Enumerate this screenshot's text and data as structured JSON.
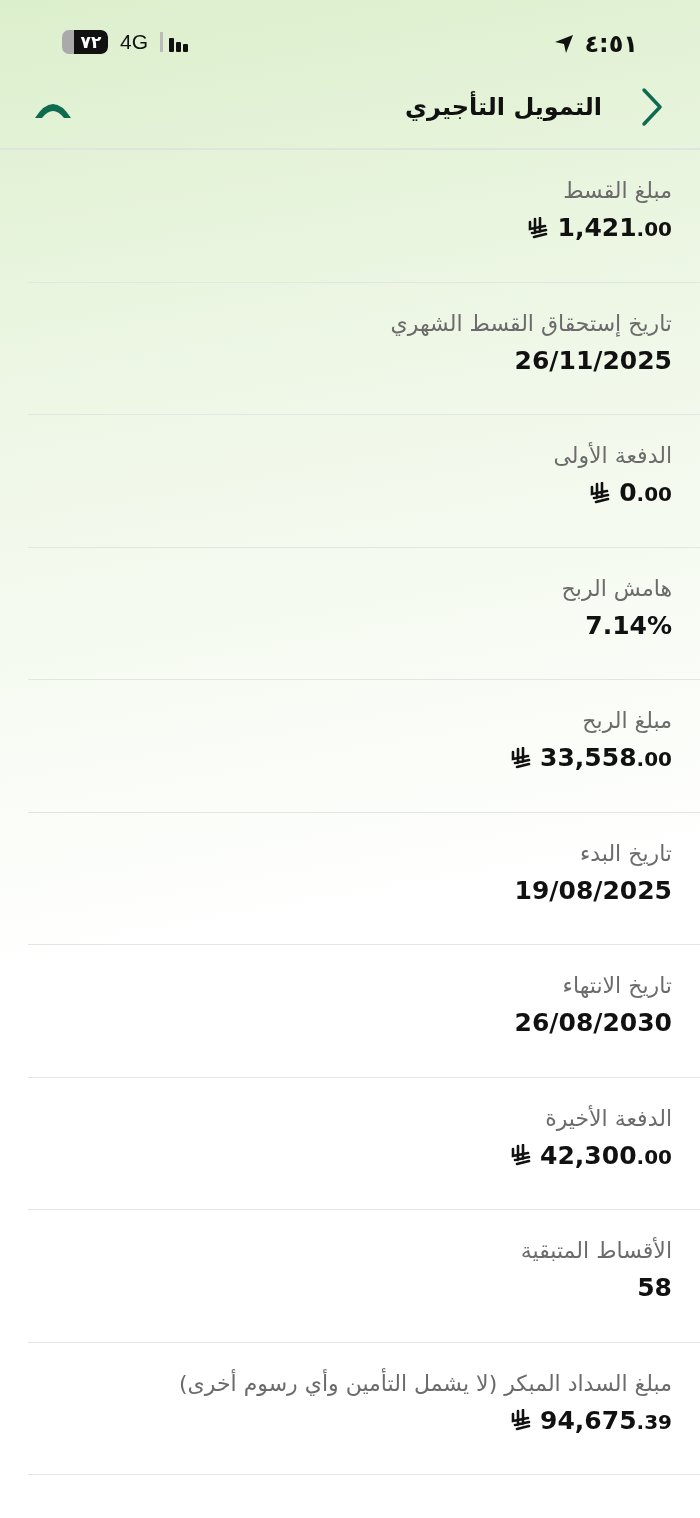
{
  "status_bar": {
    "time": "٤:٥١",
    "network": "4G",
    "battery": "٧٢"
  },
  "header": {
    "title": "التمويل التأجيري"
  },
  "rows": [
    {
      "label": "مبلغ القسط",
      "value": "1,421",
      "fraction": ".00",
      "currency": true
    },
    {
      "label": "تاريخ إستحقاق القسط الشهري",
      "value": "26/11/2025",
      "currency": false
    },
    {
      "label": "الدفعة الأولى",
      "value": "0",
      "fraction": ".00",
      "currency": true
    },
    {
      "label": "هامش الربح",
      "value": "7.14%",
      "currency": false
    },
    {
      "label": "مبلغ الربح",
      "value": "33,558",
      "fraction": ".00",
      "currency": true
    },
    {
      "label": "تاريخ البدء",
      "value": "19/08/2025",
      "currency": false
    },
    {
      "label": "تاريخ الانتهاء",
      "value": "26/08/2030",
      "currency": false
    },
    {
      "label": "الدفعة الأخيرة",
      "value": "42,300",
      "fraction": ".00",
      "currency": true
    },
    {
      "label": "الأقساط المتبقية",
      "value": "58",
      "currency": false
    },
    {
      "label": "مبلغ السداد المبكر (لا يشمل التأمين وأي رسوم أخرى)",
      "value": "94,675",
      "fraction": ".39",
      "currency": true
    }
  ]
}
